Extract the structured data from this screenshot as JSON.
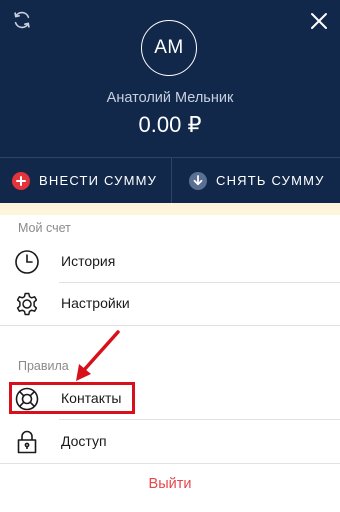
{
  "header": {
    "avatar_initials": "АМ",
    "user_name": "Анатолий Мельник",
    "balance": "0.00 ₽"
  },
  "actions": {
    "deposit_label": "ВНЕСТИ СУММУ",
    "withdraw_label": "СНЯТЬ СУММУ"
  },
  "account_section": {
    "label": "Мой счет",
    "items": [
      {
        "label": "История",
        "icon": "clock-icon"
      },
      {
        "label": "Настройки",
        "icon": "gear-icon"
      }
    ]
  },
  "rules_section": {
    "label": "Правила",
    "items": [
      {
        "label": "Контакты",
        "icon": "lifebuoy-icon"
      },
      {
        "label": "Доступ",
        "icon": "lock-icon"
      }
    ]
  },
  "logout_label": "Выйти",
  "colors": {
    "header_bg": "#12284b",
    "deposit_icon_bg": "#e3343b",
    "withdraw_icon_bg": "#5a6f93",
    "highlight": "#d8101c",
    "logout": "#e8464d"
  }
}
